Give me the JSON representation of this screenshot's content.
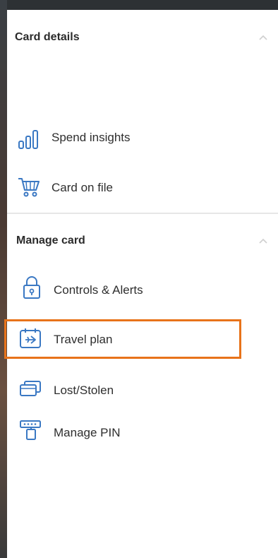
{
  "card_details": {
    "title": "Card details",
    "items": [
      {
        "label": "Spend insights",
        "icon": "bar-chart-icon"
      },
      {
        "label": "Card on file",
        "icon": "shopping-cart-icon"
      }
    ]
  },
  "manage_card": {
    "title": "Manage card",
    "items": [
      {
        "label": "Controls & Alerts",
        "icon": "lock-icon"
      },
      {
        "label": "Travel plan",
        "icon": "calendar-plane-icon",
        "highlighted": true
      },
      {
        "label": "Lost/Stolen",
        "icon": "cards-icon"
      },
      {
        "label": "Manage PIN",
        "icon": "pin-keypad-icon"
      }
    ]
  },
  "colors": {
    "icon_blue": "#3a78c3",
    "highlight_orange": "#e8731a",
    "text": "#2e2e2e"
  }
}
